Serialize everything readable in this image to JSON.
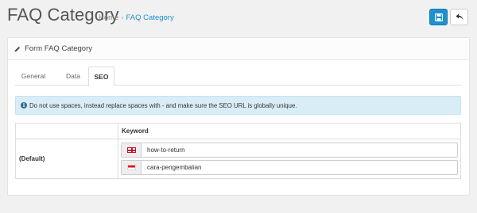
{
  "header": {
    "title": "FAQ Category",
    "breadcrumb": [
      {
        "label": "Home"
      },
      {
        "label": "FAQ Category"
      }
    ],
    "breadcrumb_separator": "›",
    "buttons": {
      "save_icon": "floppy-disk-icon",
      "back_icon": "reply-arrow-icon"
    }
  },
  "panel": {
    "title": "Form FAQ Category",
    "title_icon": "pencil-icon"
  },
  "tabs": [
    {
      "label": "General"
    },
    {
      "label": "Data"
    },
    {
      "label": "SEO",
      "active": true
    }
  ],
  "alert": {
    "icon": "info-circle-icon",
    "text": "Do not use spaces, instead replace spaces with - and make sure the SEO URL is globally unique."
  },
  "seo_table": {
    "columns": [
      "",
      "Keyword"
    ],
    "rows": [
      {
        "store": "(Default)",
        "keywords": [
          {
            "flag": "en-gb-flag-icon",
            "value": "how-to-return"
          },
          {
            "flag": "indonesia-flag-icon",
            "value": "cara-pengembalian"
          }
        ]
      }
    ]
  },
  "colors": {
    "primary": "#1e91cf",
    "alert_bg": "#d9edf7",
    "page_bg": "#f1f1f1"
  }
}
